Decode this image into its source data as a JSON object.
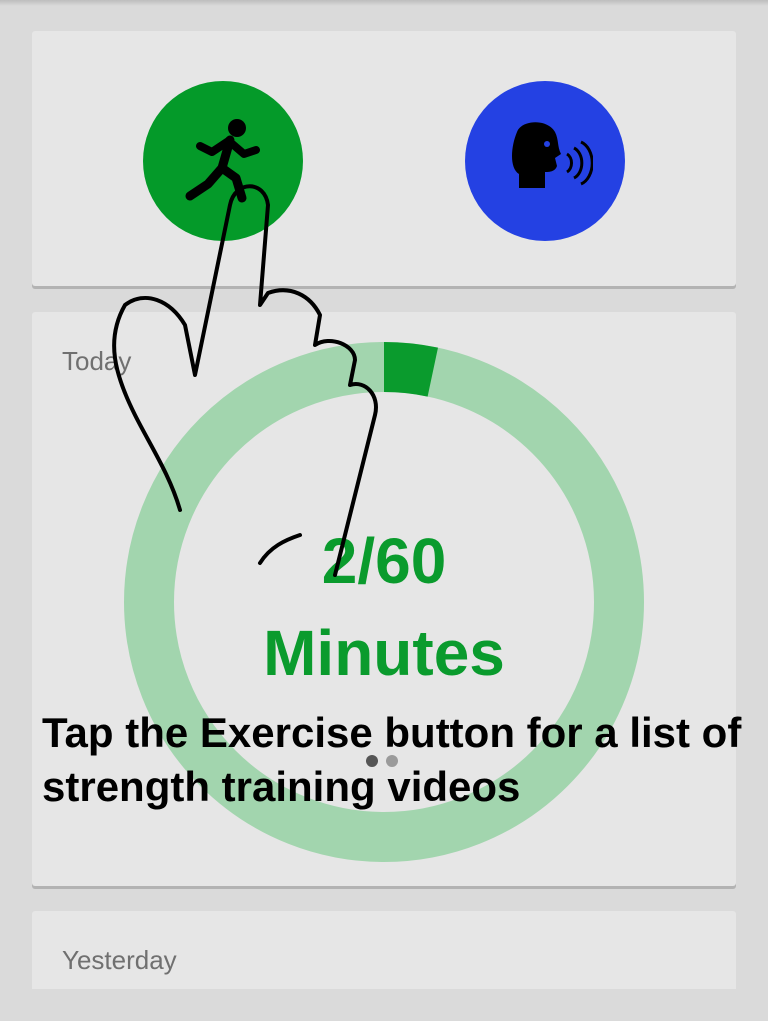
{
  "top_card": {
    "exercise_button": {
      "icon": "running-person-icon",
      "color": "#049a29"
    },
    "speak_button": {
      "icon": "speaking-head-icon",
      "color": "#2441e3"
    }
  },
  "today_card": {
    "label": "Today",
    "progress": {
      "current": 2,
      "goal": 60,
      "value_text": "2/60",
      "unit_text": "Minutes",
      "fraction": 0.0333,
      "color": "#0a9b2d",
      "track_color": "#a2d5ae"
    },
    "pager": {
      "count": 2,
      "active_index": 0
    }
  },
  "yesterday_card": {
    "label": "Yesterday"
  },
  "tutorial": {
    "text": "Tap the Exercise button for a list of strength training videos",
    "pointer_icon": "tap-hand-icon"
  }
}
